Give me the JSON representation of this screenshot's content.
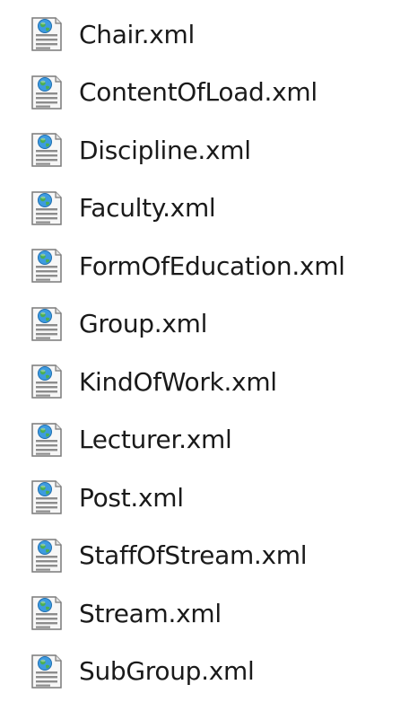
{
  "file_icon": "xml-document-globe-icon",
  "files": [
    {
      "name": "Chair.xml"
    },
    {
      "name": "ContentOfLoad.xml"
    },
    {
      "name": "Discipline.xml"
    },
    {
      "name": "Faculty.xml"
    },
    {
      "name": "FormOfEducation.xml"
    },
    {
      "name": "Group.xml"
    },
    {
      "name": "KindOfWork.xml"
    },
    {
      "name": "Lecturer.xml"
    },
    {
      "name": "Post.xml"
    },
    {
      "name": "StaffOfStream.xml"
    },
    {
      "name": "Stream.xml"
    },
    {
      "name": "SubGroup.xml"
    }
  ]
}
